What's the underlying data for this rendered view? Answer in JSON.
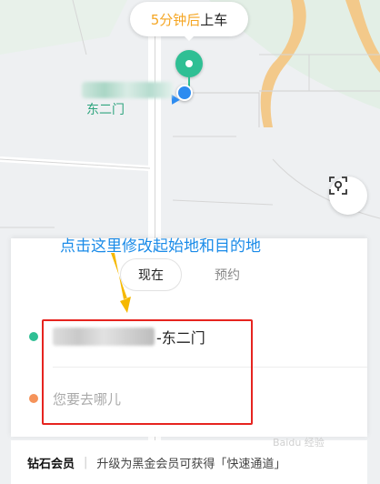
{
  "eta": {
    "highlight": "5分钟后",
    "text": "上车"
  },
  "map": {
    "label": "东二门",
    "accent": "#2fbf94",
    "road_color": "#d6d6d6",
    "park_color": "#e3efe6",
    "river_color": "#f3c98a"
  },
  "annotation": {
    "text": "点击这里修改起始地和目的地",
    "color": "#1a8be8"
  },
  "tabs": {
    "now": "现在",
    "book": "预约"
  },
  "from": {
    "suffix": "-东二门"
  },
  "to": {
    "placeholder": "您要去哪儿"
  },
  "footer": {
    "badge": "钻石会员",
    "note": "升级为黑金会员可获得「快速通道」"
  },
  "watermark": "Baidu 经验"
}
